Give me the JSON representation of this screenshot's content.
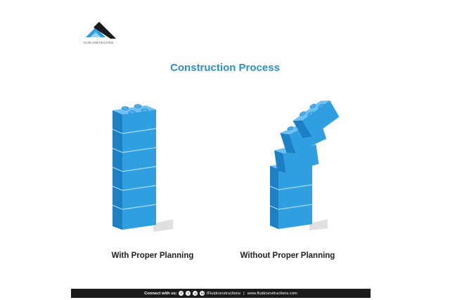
{
  "brand": {
    "name": "FLUID CONSTRUCTIONS"
  },
  "title": "Construction Process",
  "captions": {
    "left": "With Proper Planning",
    "right": "Without Proper Planning"
  },
  "footer": {
    "connect_label": "Connect with us:",
    "social_icons": [
      "facebook-icon",
      "twitter-icon",
      "instagram-icon",
      "linkedin-icon"
    ],
    "handle": "/Fluidconstructions",
    "separator": "|",
    "website": "www.fluidconstructions.com"
  },
  "colors": {
    "accent": "#2a8fd0",
    "block_front": "#2f9fe0",
    "block_side": "#1d7fc4",
    "block_top": "#6cc2f4",
    "footer_bg": "#1b1b1b"
  }
}
